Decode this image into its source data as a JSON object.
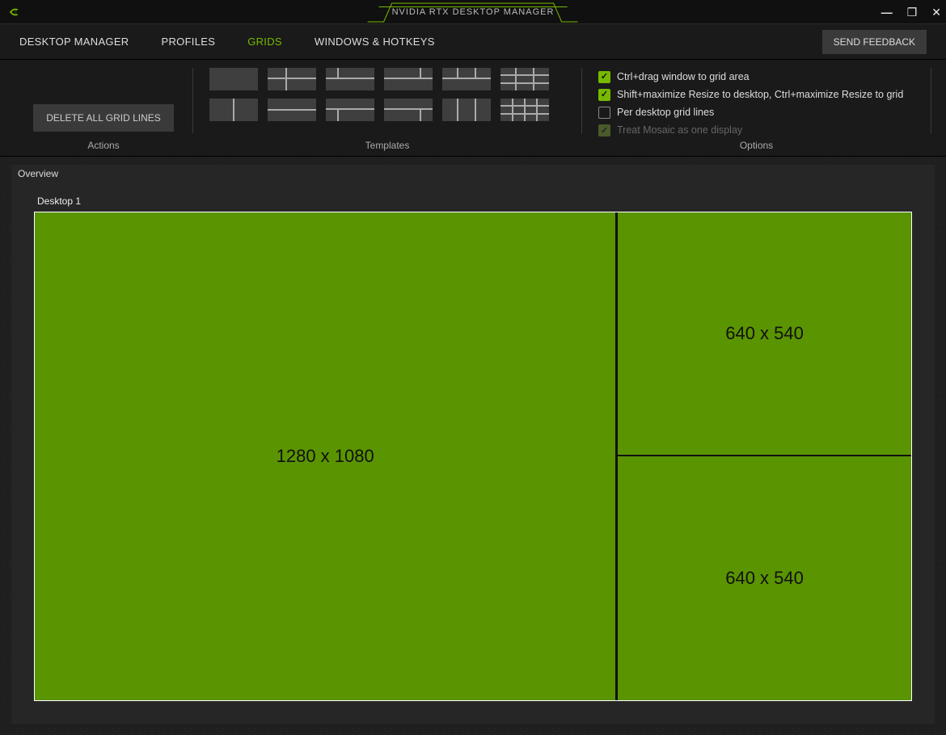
{
  "app": {
    "title": "NVIDIA RTX DESKTOP MANAGER"
  },
  "tabs": {
    "items": [
      "DESKTOP MANAGER",
      "PROFILES",
      "GRIDS",
      "WINDOWS & HOTKEYS"
    ],
    "active_index": 2,
    "feedback": "SEND FEEDBACK"
  },
  "toolbar": {
    "actions": {
      "label": "Actions",
      "delete_all": "DELETE ALL GRID LINES"
    },
    "templates": {
      "label": "Templates"
    },
    "options": {
      "label": "Options",
      "items": [
        {
          "label": "Ctrl+drag window to grid area",
          "checked": true,
          "enabled": true
        },
        {
          "label": "Shift+maximize Resize to desktop, Ctrl+maximize Resize to grid",
          "checked": true,
          "enabled": true
        },
        {
          "label": "Per desktop grid lines",
          "checked": false,
          "enabled": true
        },
        {
          "label": "Treat Mosaic as one display",
          "checked": true,
          "enabled": false
        }
      ]
    }
  },
  "overview": {
    "label": "Overview",
    "desktop": {
      "label": "Desktop 1",
      "regions": [
        {
          "name": "left",
          "size": "1280 x 1080"
        },
        {
          "name": "top-right",
          "size": "640 x 540"
        },
        {
          "name": "bottom-right",
          "size": "640 x 540"
        }
      ]
    }
  }
}
